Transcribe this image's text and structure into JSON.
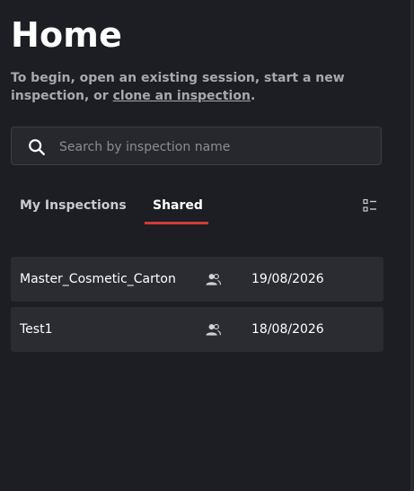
{
  "header": {
    "title": "Home"
  },
  "intro": {
    "prefix": "To begin, open an existing session, start a new inspection, or ",
    "link_label": "clone an inspection",
    "suffix": "."
  },
  "search": {
    "placeholder": "Search by inspection name",
    "value": "",
    "icon": "search-icon"
  },
  "tabs": [
    {
      "label": "My Inspections",
      "active": false
    },
    {
      "label": "Shared",
      "active": true
    }
  ],
  "colors": {
    "background": "#1c1e23",
    "row_background": "#2a2c32",
    "active_tab_underline": "#d13b3b",
    "muted_text": "#a7a9ae"
  },
  "view_toggle_icon": "list-view-icon",
  "inspections": [
    {
      "name": "Master_Cosmetic_Carton",
      "shared_icon": "shared-users-icon",
      "date": "19/08/2026"
    },
    {
      "name": "Test1",
      "shared_icon": "shared-users-icon",
      "date": "18/08/2026"
    }
  ]
}
